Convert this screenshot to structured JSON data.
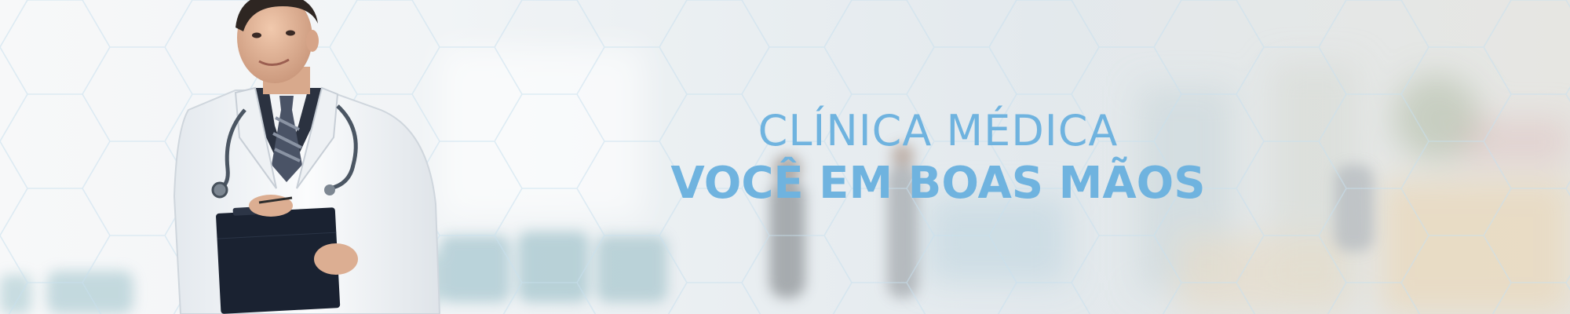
{
  "banner": {
    "headline_line1": "CLÍNICA MÉDICA",
    "headline_line2": "VOCÊ EM BOAS MÃOS",
    "accent_color": "#6fb3df"
  },
  "figure": {
    "subject": "doctor with stethoscope and clipboard"
  },
  "background": {
    "scene": "blurred hospital corridor",
    "pattern": "hexagon-pattern"
  }
}
